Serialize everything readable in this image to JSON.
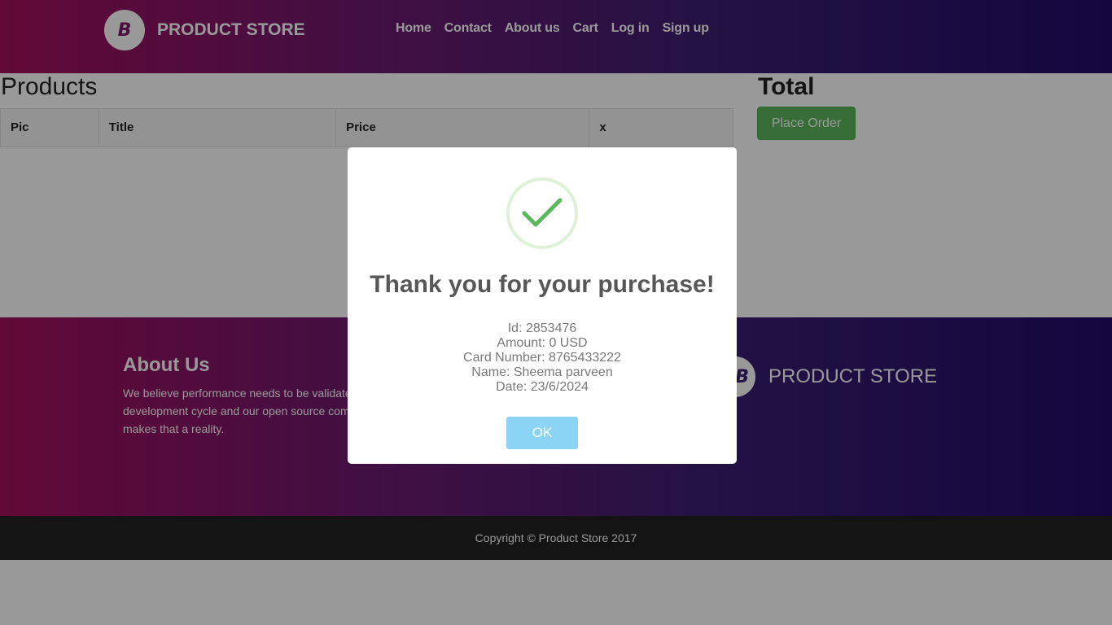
{
  "header": {
    "brand_logo_letter": "B",
    "brand_name": "PRODUCT STORE",
    "nav": [
      "Home",
      "Contact",
      "About us",
      "Cart",
      "Log in",
      "Sign up"
    ]
  },
  "main": {
    "products_title": "Products",
    "total_title": "Total",
    "table_headers": [
      "Pic",
      "Title",
      "Price",
      "x"
    ],
    "place_order_label": "Place Order"
  },
  "footer": {
    "about_heading": "About Us",
    "about_text": "We believe performance needs to be validated at every stage of the software development cycle and our open source compatible, massively scalable platform makes that a reality.",
    "brand_logo_letter": "B",
    "brand_name": "PRODUCT STORE",
    "copyright": "Copyright © Product Store 2017"
  },
  "modal": {
    "title": "Thank you for your purchase!",
    "lines": [
      "Id: 2853476",
      "Amount: 0 USD",
      "Card Number: 8765433222",
      "Name: Sheema parveen",
      "Date: 23/6/2024"
    ],
    "ok_label": "OK",
    "success_icon": "checkmark-icon"
  },
  "colors": {
    "header_gradient_start": "#a30f5c",
    "header_gradient_end": "#220c6a",
    "success_green": "#5cb85c",
    "ok_button": "#8cd4f5"
  }
}
